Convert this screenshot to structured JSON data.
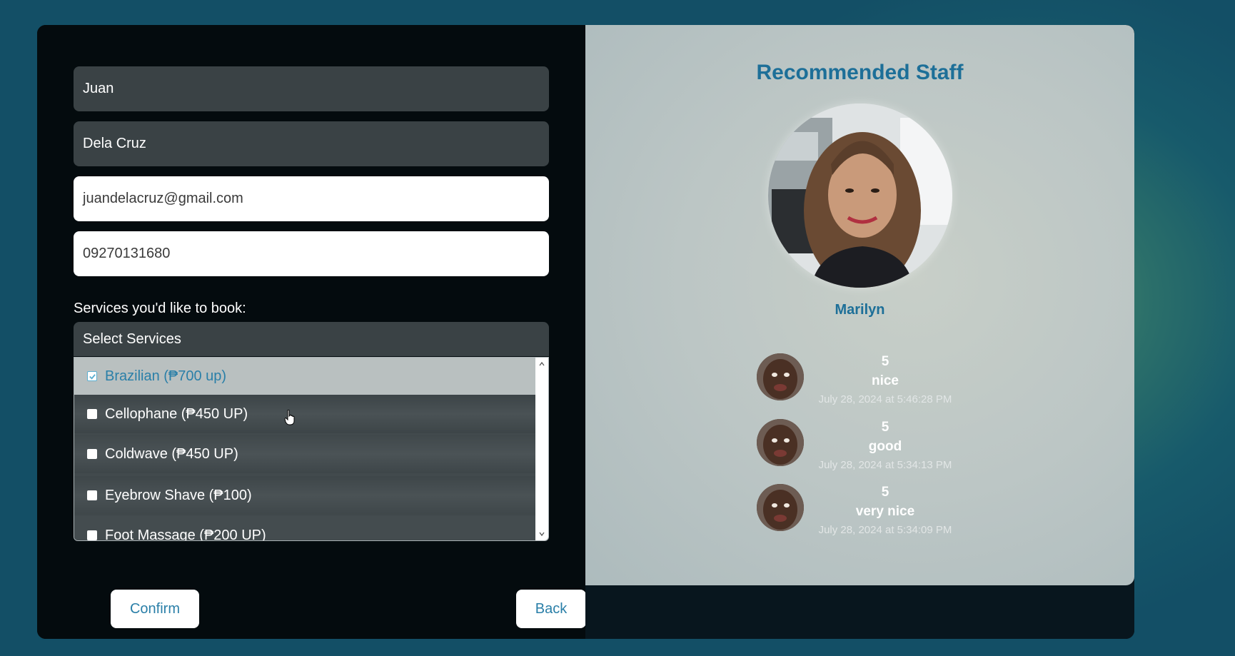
{
  "form": {
    "first_name": "Juan",
    "last_name": "Dela Cruz",
    "email": "juandelacruz@gmail.com",
    "phone": "09270131680",
    "services_label": "Services you'd like to book:",
    "select_placeholder": "Select Services",
    "options": [
      {
        "label": "Brazilian (₱700 up)",
        "checked": true
      },
      {
        "label": "Cellophane (₱450 UP)",
        "checked": false
      },
      {
        "label": "Coldwave (₱450 UP)",
        "checked": false
      },
      {
        "label": "Eyebrow Shave (₱100)",
        "checked": false
      },
      {
        "label": "Foot Massage (₱200 UP)",
        "checked": false
      }
    ],
    "confirm_label": "Confirm",
    "back_label": "Back"
  },
  "staff": {
    "title": "Recommended Staff",
    "name": "Marilyn",
    "reviews": [
      {
        "rating": "5",
        "comment": "nice",
        "date": "July 28, 2024 at 5:46:28 PM"
      },
      {
        "rating": "5",
        "comment": "good",
        "date": "July 28, 2024 at 5:34:13 PM"
      },
      {
        "rating": "5",
        "comment": "very nice",
        "date": "July 28, 2024 at 5:34:09 PM"
      }
    ]
  },
  "colors": {
    "accent": "#1d6f98",
    "panel": "#c0c9c7",
    "form_bg": "#040b0e"
  }
}
